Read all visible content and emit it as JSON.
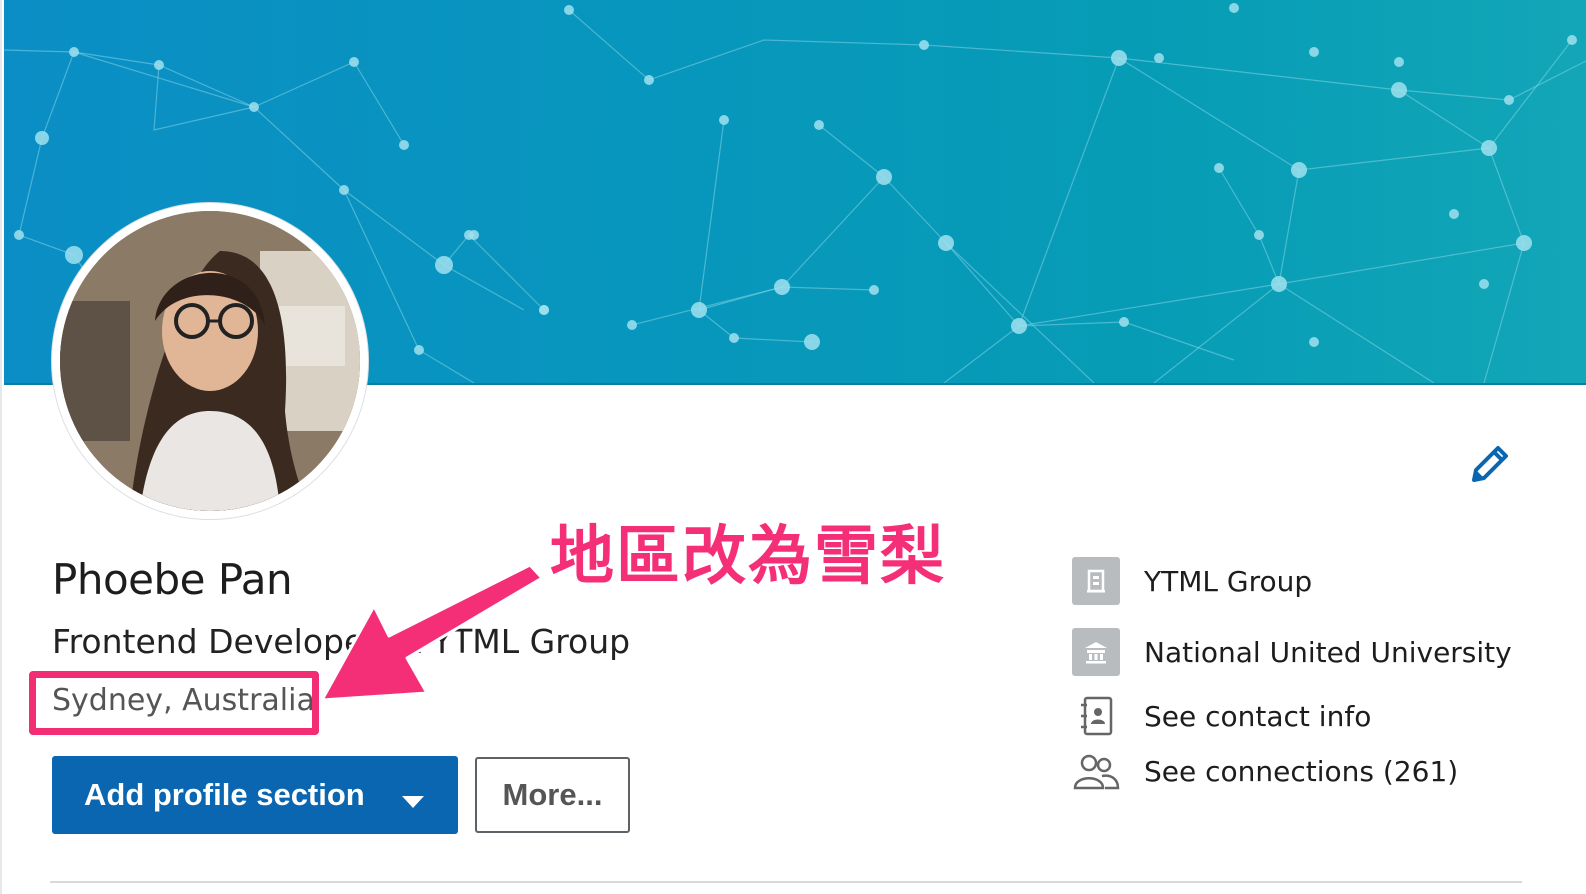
{
  "profile": {
    "name": "Phoebe Pan",
    "headline": "Frontend Developer at YTML Group",
    "location": "Sydney, Australia"
  },
  "actions": {
    "add_section_label": "Add profile section",
    "more_label": "More..."
  },
  "sidebar": {
    "items": [
      {
        "label": "YTML Group",
        "icon": "company-icon"
      },
      {
        "label": "National United University",
        "icon": "school-icon"
      },
      {
        "label": "See contact info",
        "icon": "contact-card-icon"
      },
      {
        "label": "See connections (261)",
        "icon": "connections-icon"
      }
    ]
  },
  "annotation": {
    "text": "地區改為雪梨",
    "color": "#f52f77"
  },
  "colors": {
    "primary_button": "#0a66b0",
    "banner": "#0796bd",
    "highlight": "#f22d74"
  }
}
